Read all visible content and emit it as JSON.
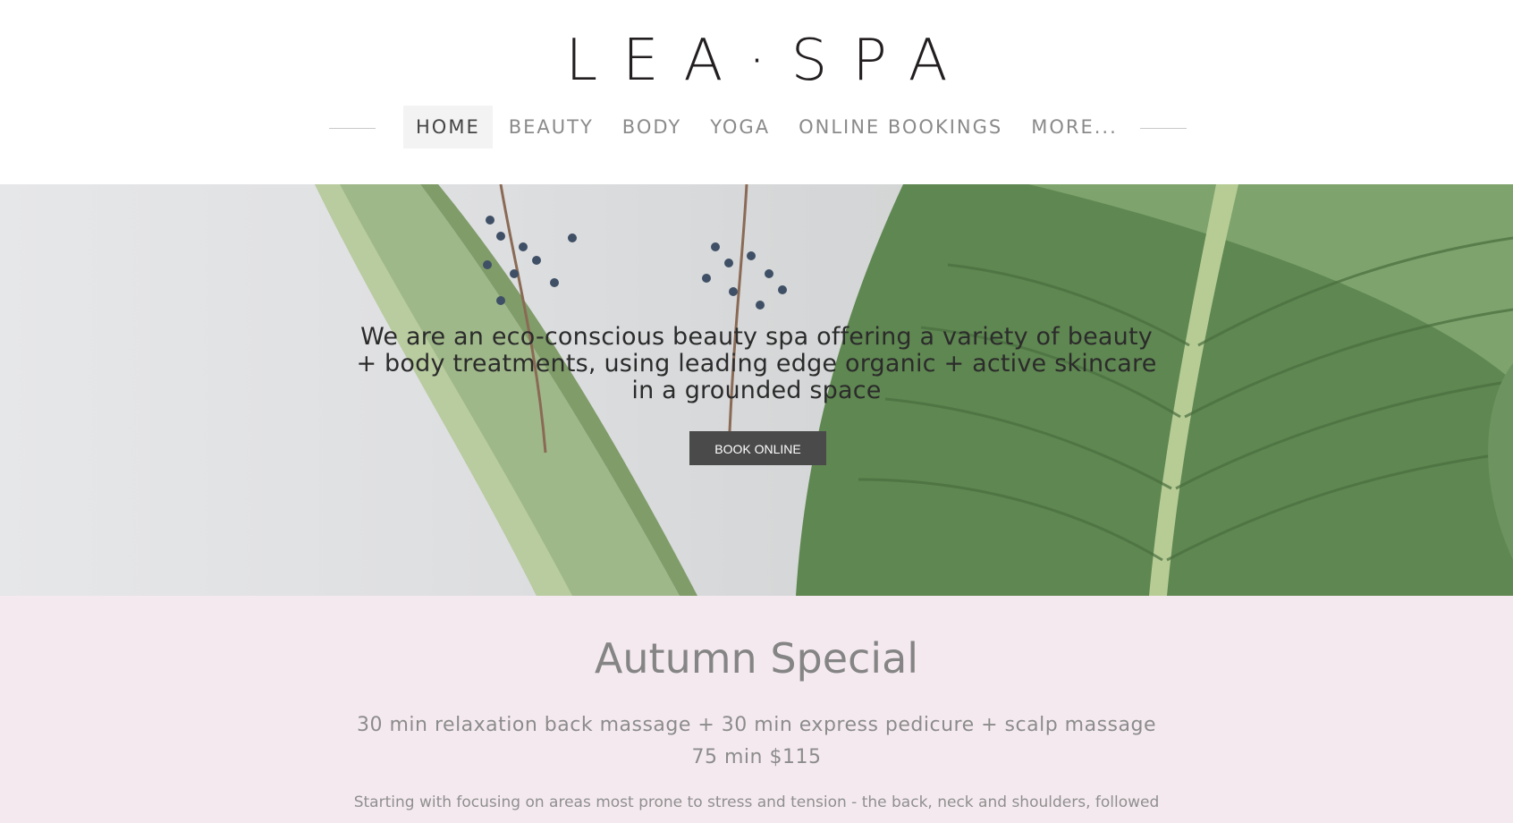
{
  "header": {
    "logo": "LEA·SPA",
    "nav": [
      {
        "label": "HOME",
        "active": true
      },
      {
        "label": "BEAUTY",
        "active": false
      },
      {
        "label": "BODY",
        "active": false
      },
      {
        "label": "YOGA",
        "active": false
      },
      {
        "label": "ONLINE BOOKINGS",
        "active": false
      },
      {
        "label": "MORE...",
        "active": false
      }
    ]
  },
  "hero": {
    "lines": [
      "We are an eco-conscious beauty spa offering a variety of beauty",
      "+ body treatments, using leading edge organic + active skincare",
      "in a grounded space"
    ],
    "button_label": "BOOK ONLINE"
  },
  "special": {
    "title": "Autumn Special",
    "line1": "30 min relaxation back massage + 30 min express pedicure + scalp massage",
    "line2": "75 min $115",
    "description": "Starting with focusing on areas most prone to stress and tension - the back, neck and shoulders, followed"
  },
  "colors": {
    "accent_button": "#4a4a4a",
    "special_bg": "#f4e9ef",
    "leaf_green": "#6f9560"
  }
}
